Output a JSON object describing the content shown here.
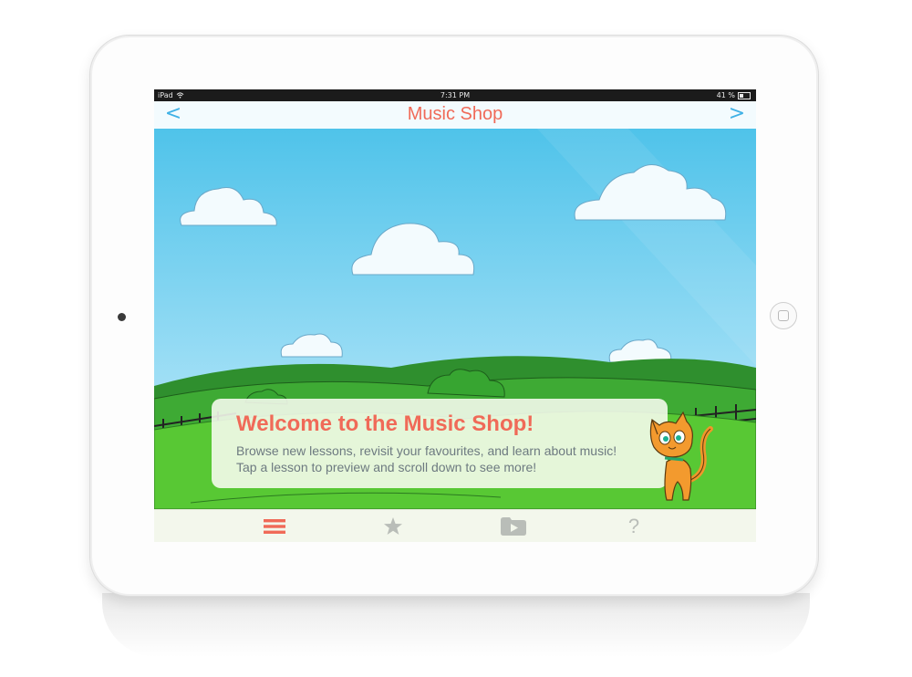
{
  "status_bar": {
    "carrier": "iPad",
    "time": "7:31 PM",
    "battery_text": "41 %",
    "battery_level": 0.41
  },
  "nav": {
    "title": "Music Shop",
    "back_glyph": "<",
    "forward_glyph": ">"
  },
  "welcome": {
    "heading": "Welcome to the Music Shop!",
    "body": "Browse new lessons, revisit your favourites, and learn about music! Tap a lesson to preview and scroll down to see more!"
  },
  "tabs": [
    {
      "icon": "menu-icon",
      "active": true
    },
    {
      "icon": "star-icon",
      "active": false
    },
    {
      "icon": "play-folder-icon",
      "active": false
    },
    {
      "icon": "help-icon",
      "glyph": "?",
      "active": false
    }
  ],
  "colors": {
    "accent": "#f06a58",
    "nav_arrow": "#3fb1e6",
    "tab_inactive": "#b9bdb8",
    "sky_top": "#4fc3ea",
    "grass": "#58c834"
  }
}
